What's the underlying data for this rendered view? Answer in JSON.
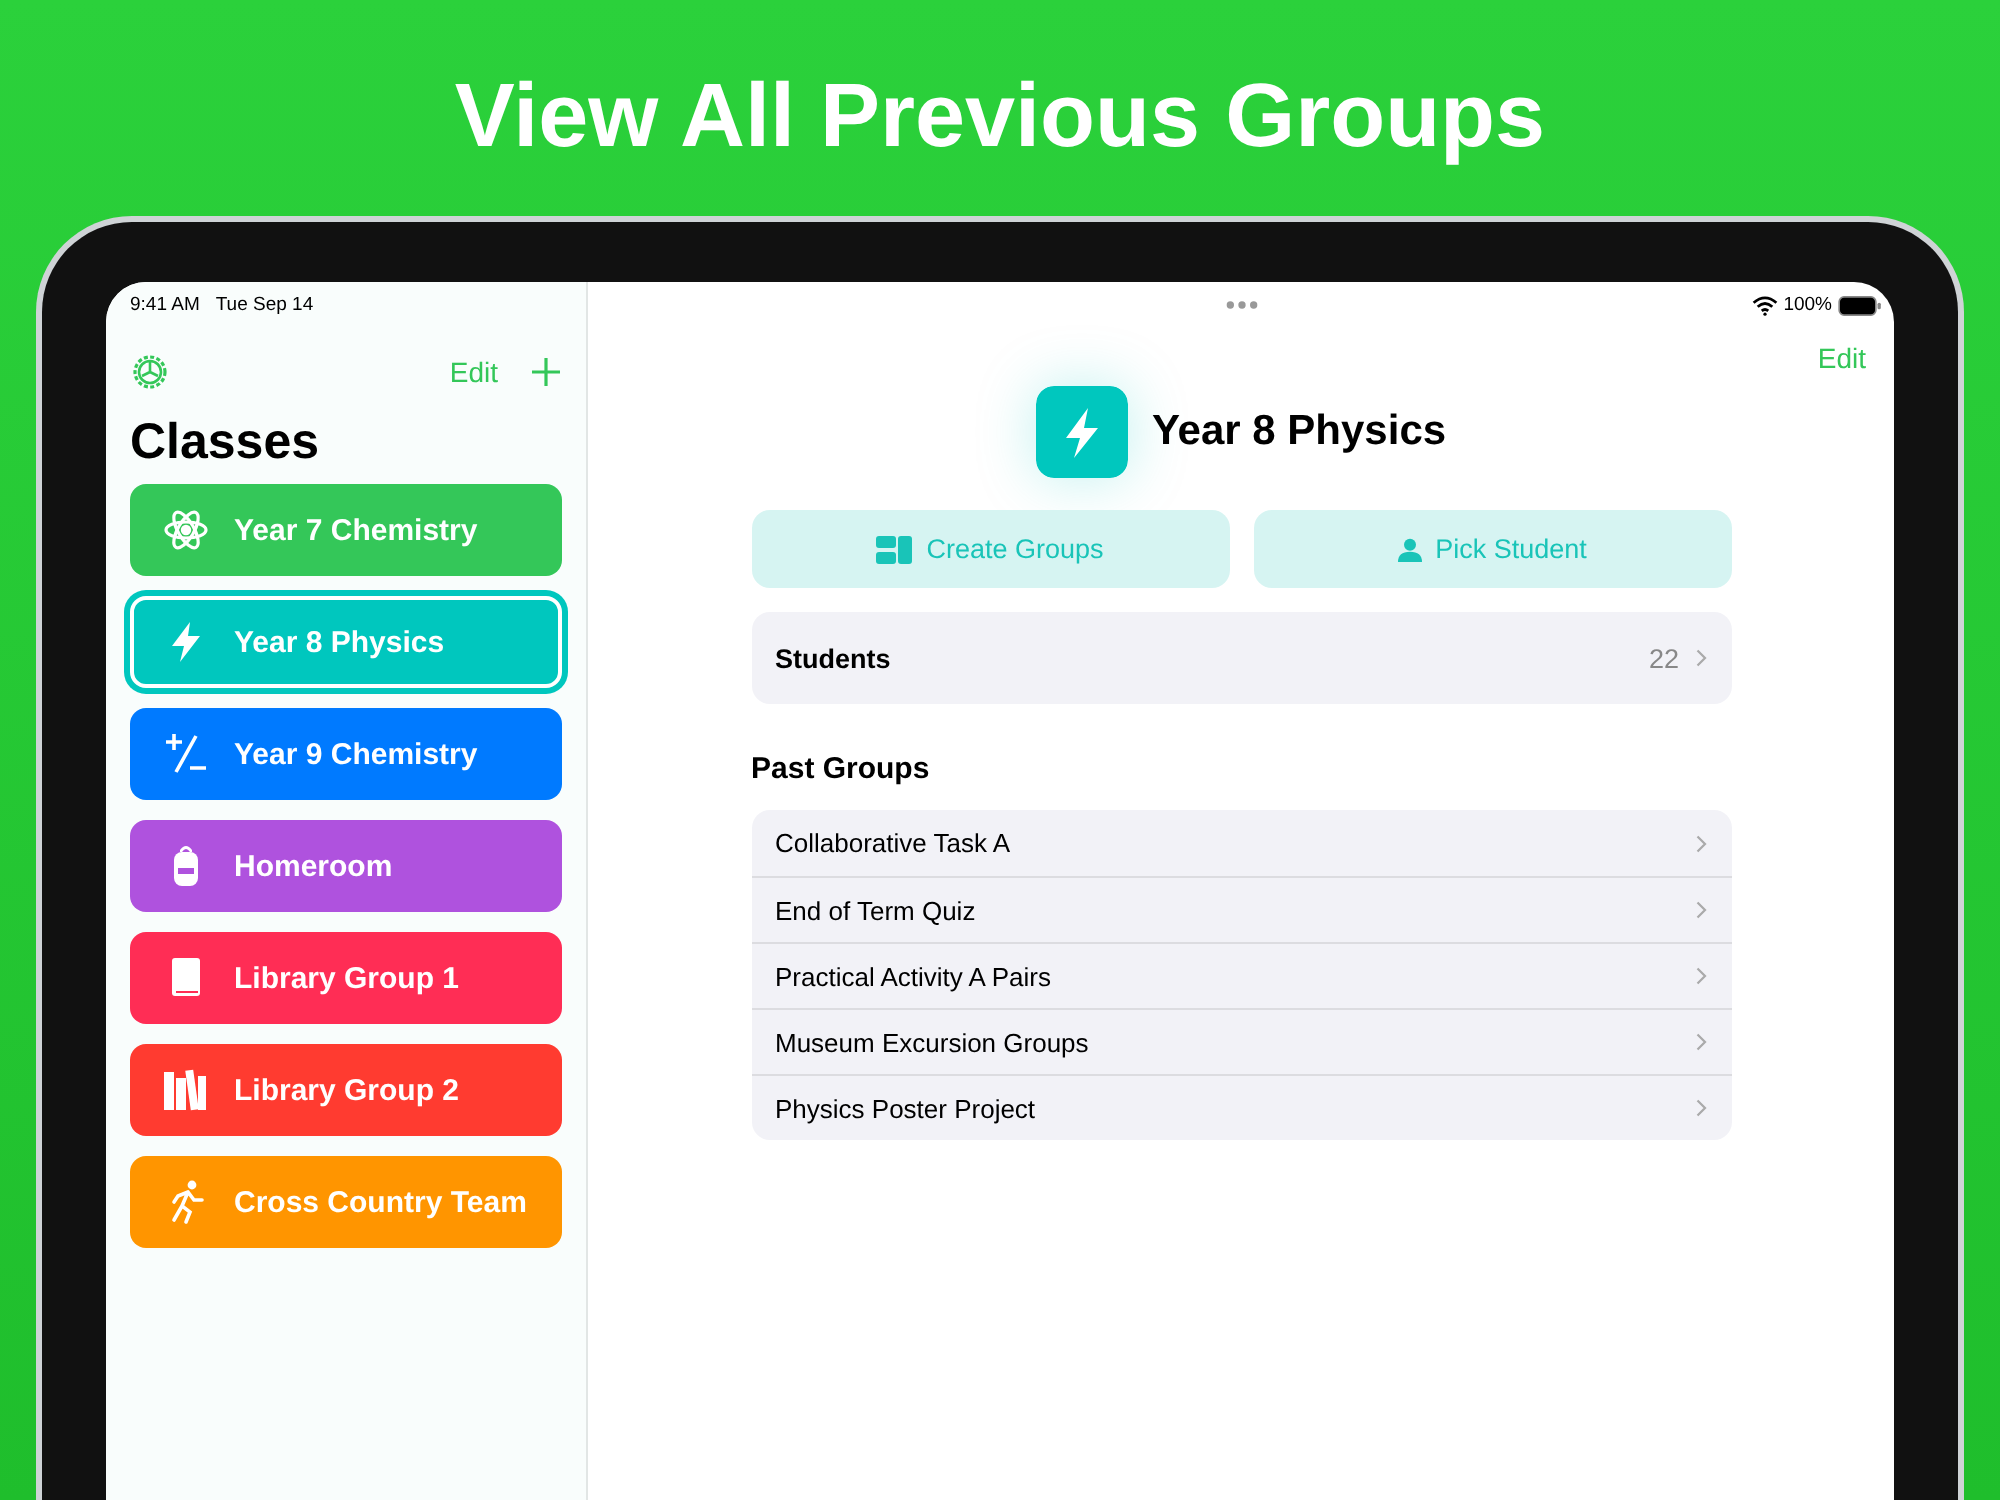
{
  "headline": "View All Previous Groups",
  "status_bar": {
    "time": "9:41 AM",
    "date": "Tue Sep 14",
    "battery": "100%"
  },
  "sidebar": {
    "edit": "Edit",
    "title": "Classes",
    "items": [
      {
        "label": "Year 7 Chemistry",
        "kind": "atom",
        "color": "#34c759",
        "selected": false
      },
      {
        "label": "Year 8 Physics",
        "kind": "bolt",
        "color": "#00c7be",
        "selected": true
      },
      {
        "label": "Year 9 Chemistry",
        "kind": "plusminus",
        "color": "#007aff",
        "selected": false
      },
      {
        "label": "Homeroom",
        "kind": "backpack",
        "color": "#af52de",
        "selected": false
      },
      {
        "label": "Library Group 1",
        "kind": "book",
        "color": "#ff2d55",
        "selected": false
      },
      {
        "label": "Library Group 2",
        "kind": "books",
        "color": "#ff3b30",
        "selected": false
      },
      {
        "label": "Cross Country Team",
        "kind": "runner",
        "color": "#ff9500",
        "selected": false
      }
    ]
  },
  "detail": {
    "edit": "Edit",
    "title": "Year 8 Physics",
    "buttons": [
      {
        "label": "Create Groups",
        "kind": "groups"
      },
      {
        "label": "Pick Student",
        "kind": "person"
      }
    ],
    "students": {
      "label": "Students",
      "count": "22"
    },
    "past_groups": {
      "title": "Past Groups",
      "items": [
        "Collaborative Task A",
        "End of Term Quiz",
        "Practical Activity A Pairs",
        "Museum Excursion Groups",
        "Physics Poster Project"
      ]
    }
  }
}
